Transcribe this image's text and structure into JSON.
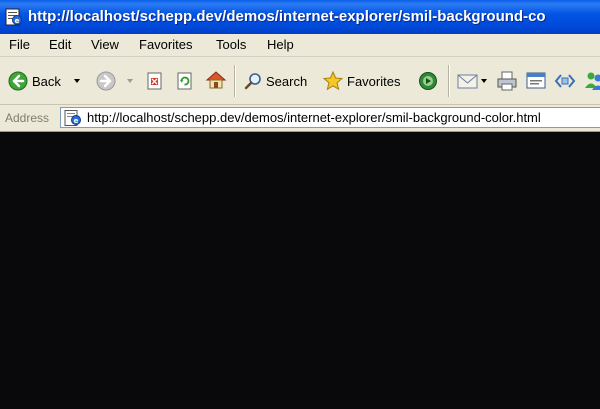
{
  "window": {
    "title": "http://localhost/schepp.dev/demos/internet-explorer/smil-background-co",
    "icon": "ie-page-icon"
  },
  "menu": [
    "File",
    "Edit",
    "View",
    "Favorites",
    "Tools",
    "Help"
  ],
  "toolbar": {
    "back_label": "Back",
    "search_label": "Search",
    "favorites_label": "Favorites"
  },
  "address": {
    "label": "Address",
    "url": "http://localhost/schepp.dev/demos/internet-explorer/smil-background-color.html"
  },
  "content": {
    "background_color": "#09080A"
  },
  "colors": {
    "titlebar": "#0048D8",
    "chrome": "#ECE9D8"
  }
}
